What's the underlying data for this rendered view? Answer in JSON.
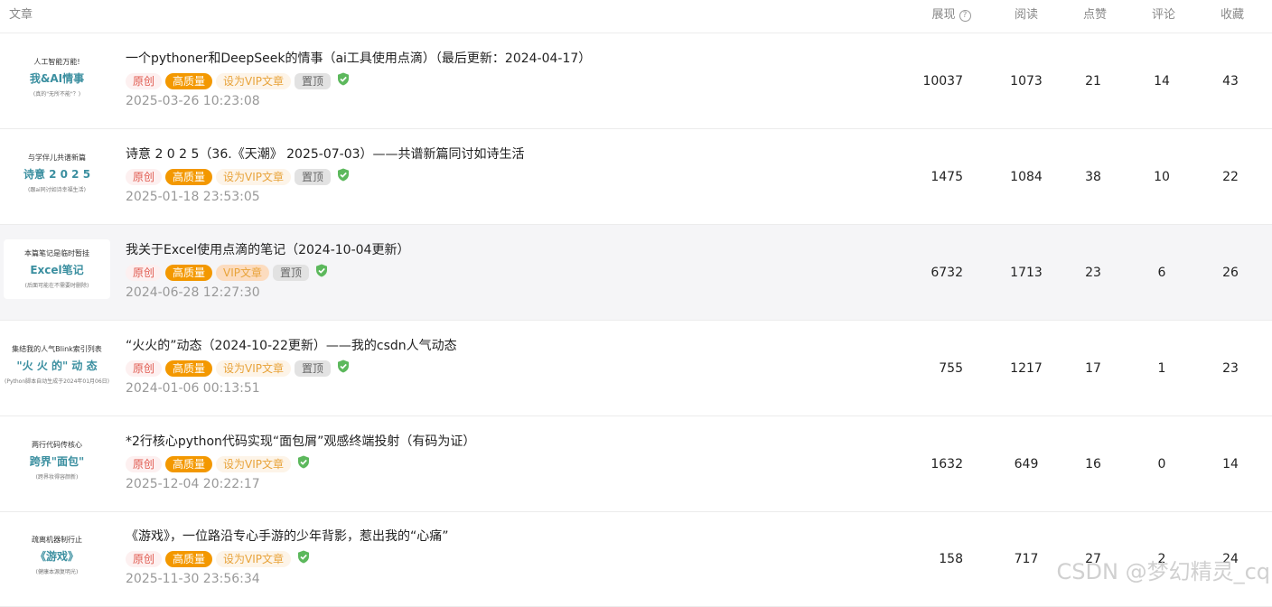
{
  "header": {
    "article": "文章",
    "views": "展现",
    "reads": "阅读",
    "likes": "点赞",
    "comments": "评论",
    "favorites": "收藏"
  },
  "articles": [
    {
      "thumb": {
        "line1": "人工智能万能!",
        "line2": "我&AI情事",
        "line3": "(真的\"无所不能\"？)"
      },
      "title": "一个pythoner和DeepSeek的情事（ai工具使用点滴）（最后更新：2024-04-17）",
      "tag_original": "原创",
      "tag_quality": "高质量",
      "tag_vip": "设为VIP文章",
      "tag_top": "置顶",
      "date": "2025-03-26 10:23:08",
      "views": "10037",
      "reads": "1073",
      "likes": "21",
      "comments": "14",
      "favorites": "43"
    },
    {
      "thumb": {
        "line1": "与学伴儿共谱新篇",
        "line2": "诗意 2 0 2 5",
        "line3": "(跟ai同讨如诗幸福生活)"
      },
      "title": "诗意 2 0 2 5（36.《天潮》 2025-07-03）——共谱新篇同讨如诗生活",
      "tag_original": "原创",
      "tag_quality": "高质量",
      "tag_vip": "设为VIP文章",
      "tag_top": "置顶",
      "date": "2025-01-18 23:53:05",
      "views": "1475",
      "reads": "1084",
      "likes": "38",
      "comments": "10",
      "favorites": "22"
    },
    {
      "thumb": {
        "line1": "本篇笔记是临时暂挂",
        "line2": "Excel笔记",
        "line3": "(后面可能在不需要时删除)"
      },
      "title": "我关于Excel使用点滴的笔记（2024-10-04更新）",
      "tag_original": "原创",
      "tag_quality": "高质量",
      "tag_vip": "VIP文章",
      "tag_top": "置顶",
      "date": "2024-06-28 12:27:30",
      "views": "6732",
      "reads": "1713",
      "likes": "23",
      "comments": "6",
      "favorites": "26"
    },
    {
      "thumb": {
        "line1": "集结我的人气Blink索引列表",
        "line2": "\"火 火 的\" 动 态",
        "line3": "(Python脚本自动生成于2024年01月06日)"
      },
      "title": "“火火的”动态（2024-10-22更新）——我的csdn人气动态",
      "tag_original": "原创",
      "tag_quality": "高质量",
      "tag_vip": "设为VIP文章",
      "tag_top": "置顶",
      "date": "2024-01-06 00:13:51",
      "views": "755",
      "reads": "1217",
      "likes": "17",
      "comments": "1",
      "favorites": "23"
    },
    {
      "thumb": {
        "line1": "两行代码传核心",
        "line2": "跨界\"面包\"",
        "line3": "(跨界妆得容颜新)"
      },
      "title": "*2行核心python代码实现“面包屑”观感终端投射（有码为证）",
      "tag_original": "原创",
      "tag_quality": "高质量",
      "tag_vip": "设为VIP文章",
      "tag_top": "",
      "date": "2025-12-04 20:22:17",
      "views": "1632",
      "reads": "649",
      "likes": "16",
      "comments": "0",
      "favorites": "14"
    },
    {
      "thumb": {
        "line1": "疏离机器制行止",
        "line2": "《游戏》",
        "line3": "(健康本源复明光)"
      },
      "title": "《游戏》，一位路沿专心手游的少年背影，惹出我的“心痛”",
      "tag_original": "原创",
      "tag_quality": "高质量",
      "tag_vip": "设为VIP文章",
      "tag_top": "",
      "date": "2025-11-30 23:56:34",
      "views": "158",
      "reads": "717",
      "likes": "27",
      "comments": "2",
      "favorites": "24"
    }
  ],
  "watermark": "CSDN @梦幻精灵_cq",
  "colors": {
    "quality": "#f39800",
    "original_text": "#e05a4f",
    "vip_text": "#e8a33a",
    "shield": "#5cb85c",
    "thumb_title": "#3b8fa0"
  }
}
